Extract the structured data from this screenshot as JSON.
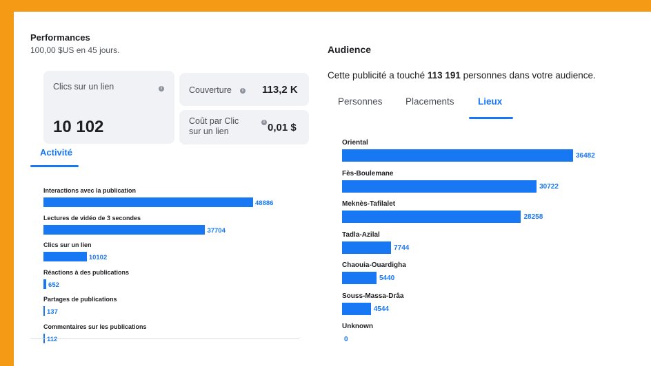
{
  "performance": {
    "title": "Performances",
    "subtitle": "100,00 $US en 45 jours.",
    "cards": {
      "clicks_label": "Clics sur un lien",
      "clicks_value": "10 102",
      "coverage_label": "Couverture",
      "coverage_value": "113,2 K",
      "cpc_label_line1": "Coût par Clic",
      "cpc_label_line2": "sur un lien",
      "cpc_value": "0,01 $"
    },
    "tab": "Activité",
    "metrics": [
      {
        "label": "Interactions avec la publication",
        "value": 48886,
        "display": "48886"
      },
      {
        "label": "Lectures de vidéo de 3 secondes",
        "value": 37704,
        "display": "37704"
      },
      {
        "label": "Clics sur un lien",
        "value": 10102,
        "display": "10102"
      },
      {
        "label": "Réactions à des publications",
        "value": 652,
        "display": "652"
      },
      {
        "label": "Partages de publications",
        "value": 137,
        "display": "137"
      },
      {
        "label": "Commentaires sur les publications",
        "value": 112,
        "display": "112"
      }
    ]
  },
  "audience": {
    "title": "Audience",
    "reach_prefix": "Cette publicité a touché ",
    "reach_number": "113 191",
    "reach_suffix": " personnes dans votre audience.",
    "tabs": [
      "Personnes",
      "Placements",
      "Lieux"
    ],
    "active_tab": "Lieux",
    "locations": [
      {
        "label": "Oriental",
        "value": 36482,
        "display": "36482"
      },
      {
        "label": "Fès-Boulemane",
        "value": 30722,
        "display": "30722"
      },
      {
        "label": "Meknès-Tafilalet",
        "value": 28258,
        "display": "28258"
      },
      {
        "label": "Tadla-Azilal",
        "value": 7744,
        "display": "7744"
      },
      {
        "label": "Chaouia-Ouardigha",
        "value": 5440,
        "display": "5440"
      },
      {
        "label": "Souss-Massa-Drâa",
        "value": 4544,
        "display": "4544"
      },
      {
        "label": "Unknown",
        "value": 0,
        "display": "0"
      }
    ]
  },
  "colors": {
    "accent": "#1877f2",
    "frame": "#f59a14",
    "card_bg": "#f0f2f5"
  },
  "icons": {
    "info": "info-icon"
  }
}
